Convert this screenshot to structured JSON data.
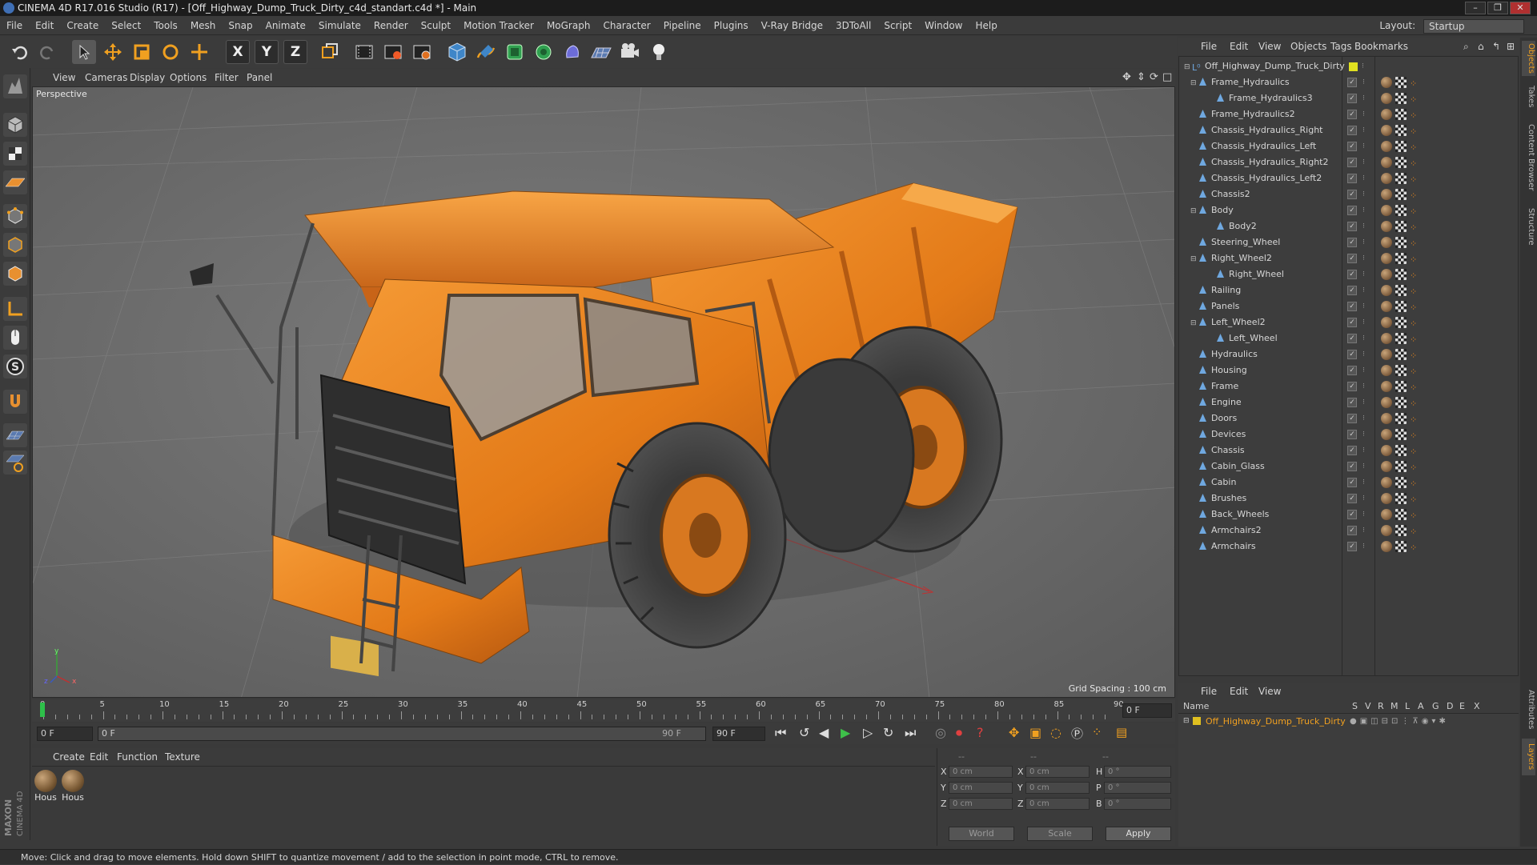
{
  "window": {
    "title": "CINEMA 4D R17.016 Studio (R17) - [Off_Highway_Dump_Truck_Dirty_c4d_standart.c4d *] - Main",
    "controls": [
      "–",
      "❐",
      "✕"
    ]
  },
  "menubar": {
    "items": [
      "File",
      "Edit",
      "Create",
      "Select",
      "Tools",
      "Mesh",
      "Snap",
      "Animate",
      "Simulate",
      "Render",
      "Sculpt",
      "Motion Tracker",
      "MoGraph",
      "Character",
      "Pipeline",
      "Plugins",
      "V-Ray Bridge",
      "3DToAll",
      "Script",
      "Window",
      "Help"
    ],
    "layout_label": "Layout:",
    "layout_value": "Startup"
  },
  "toolbar": {
    "axis_x": "X",
    "axis_y": "Y",
    "axis_z": "Z"
  },
  "viewport": {
    "menu": [
      "View",
      "Cameras",
      "Display",
      "Options",
      "Filter",
      "Panel"
    ],
    "camera_label": "Perspective",
    "grid_spacing": "Grid Spacing : 100 cm",
    "axis_y": "y",
    "axis_x": "x",
    "axis_z": "z"
  },
  "timeline": {
    "ticks": [
      "0",
      "5",
      "10",
      "15",
      "20",
      "25",
      "30",
      "35",
      "40",
      "45",
      "50",
      "55",
      "60",
      "65",
      "70",
      "75",
      "80",
      "85",
      "90"
    ],
    "current_frame": "0 F",
    "start_frame": "0 F",
    "range_start": "0 F",
    "range_end": "90 F",
    "end_frame": "90 F"
  },
  "material_manager": {
    "menu": [
      "Create",
      "Edit",
      "Function",
      "Texture"
    ],
    "materials": [
      "Hous",
      "Hous"
    ]
  },
  "coordinates": {
    "header": [
      "--",
      "--",
      "--"
    ],
    "rows": [
      {
        "axis": "X",
        "pos": "0 cm",
        "axis2": "X",
        "size": "0 cm",
        "rot_label": "H",
        "rot": "0 °"
      },
      {
        "axis": "Y",
        "pos": "0 cm",
        "axis2": "Y",
        "size": "0 cm",
        "rot_label": "P",
        "rot": "0 °"
      },
      {
        "axis": "Z",
        "pos": "0 cm",
        "axis2": "Z",
        "size": "0 cm",
        "rot_label": "B",
        "rot": "0 °"
      }
    ],
    "mode1": "World",
    "mode2": "Scale",
    "apply": "Apply"
  },
  "object_manager": {
    "menu": [
      "File",
      "Edit",
      "View",
      "Objects",
      "Tags",
      "Bookmarks"
    ],
    "root": "Off_Highway_Dump_Truck_Dirty",
    "objects": [
      {
        "name": "Frame_Hydraulics",
        "level": 1,
        "expand": true
      },
      {
        "name": "Frame_Hydraulics3",
        "level": 2,
        "expand": false
      },
      {
        "name": "Frame_Hydraulics2",
        "level": 1,
        "expand": false
      },
      {
        "name": "Chassis_Hydraulics_Right",
        "level": 1,
        "expand": false
      },
      {
        "name": "Chassis_Hydraulics_Left",
        "level": 1,
        "expand": false
      },
      {
        "name": "Chassis_Hydraulics_Right2",
        "level": 1,
        "expand": false
      },
      {
        "name": "Chassis_Hydraulics_Left2",
        "level": 1,
        "expand": false
      },
      {
        "name": "Chassis2",
        "level": 1,
        "expand": false
      },
      {
        "name": "Body",
        "level": 1,
        "expand": true
      },
      {
        "name": "Body2",
        "level": 2,
        "expand": false
      },
      {
        "name": "Steering_Wheel",
        "level": 1,
        "expand": false
      },
      {
        "name": "Right_Wheel2",
        "level": 1,
        "expand": true
      },
      {
        "name": "Right_Wheel",
        "level": 2,
        "expand": false
      },
      {
        "name": "Railing",
        "level": 1,
        "expand": false
      },
      {
        "name": "Panels",
        "level": 1,
        "expand": false
      },
      {
        "name": "Left_Wheel2",
        "level": 1,
        "expand": true
      },
      {
        "name": "Left_Wheel",
        "level": 2,
        "expand": false
      },
      {
        "name": "Hydraulics",
        "level": 1,
        "expand": false
      },
      {
        "name": "Housing",
        "level": 1,
        "expand": false
      },
      {
        "name": "Frame",
        "level": 1,
        "expand": false
      },
      {
        "name": "Engine",
        "level": 1,
        "expand": false
      },
      {
        "name": "Doors",
        "level": 1,
        "expand": false
      },
      {
        "name": "Devices",
        "level": 1,
        "expand": false
      },
      {
        "name": "Chassis",
        "level": 1,
        "expand": false
      },
      {
        "name": "Cabin_Glass",
        "level": 1,
        "expand": false
      },
      {
        "name": "Cabin",
        "level": 1,
        "expand": false
      },
      {
        "name": "Brushes",
        "level": 1,
        "expand": false
      },
      {
        "name": "Back_Wheels",
        "level": 1,
        "expand": false
      },
      {
        "name": "Armchairs2",
        "level": 1,
        "expand": false
      },
      {
        "name": "Armchairs",
        "level": 1,
        "expand": false
      }
    ]
  },
  "attributes": {
    "menu": [
      "File",
      "Edit",
      "View"
    ],
    "columns": [
      "Name",
      "S",
      "V",
      "R",
      "M",
      "L",
      "A",
      "G",
      "D",
      "E",
      "X"
    ],
    "item": "Off_Highway_Dump_Truck_Dirty"
  },
  "right_tabs": [
    "Objects",
    "Takes",
    "Content Browser",
    "Structure",
    "Attributes",
    "Layers"
  ],
  "statusbar": {
    "text": "Move: Click and drag to move elements. Hold down SHIFT to quantize movement / add to the selection in point mode, CTRL to remove."
  },
  "brand": {
    "maxon": "MAXON",
    "product": "CINEMA 4D"
  },
  "colors": {
    "accent_orange": "#f08a1c",
    "selected_text": "#f0a020",
    "object_icon": "#6fa8e0",
    "truck_orange": "#e8821e"
  }
}
